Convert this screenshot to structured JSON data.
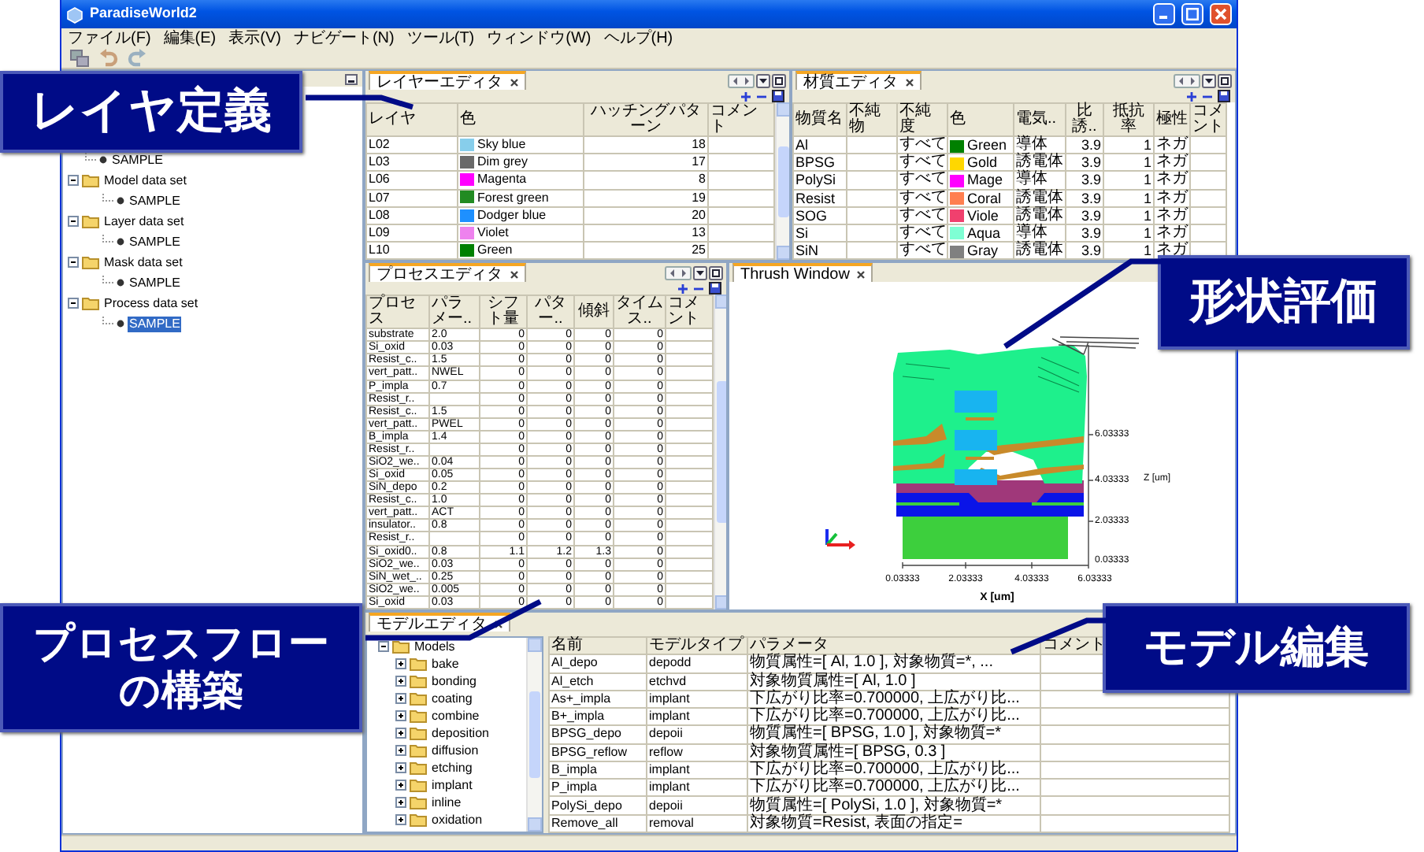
{
  "window": {
    "title": "ParadiseWorld2"
  },
  "menu": [
    "ファイル(F)",
    "編集(E)",
    "表示(V)",
    "ナビゲート(N)",
    "ツール(T)",
    "ウィンドウ(W)",
    "ヘルプ(H)"
  ],
  "navigator": {
    "tree": [
      {
        "kind": "leaf",
        "label": "SAMPLE",
        "selected": false
      },
      {
        "kind": "folder",
        "label": "Model data set",
        "expanded": true,
        "children": [
          {
            "kind": "leaf",
            "label": "SAMPLE",
            "selected": false
          }
        ]
      },
      {
        "kind": "folder",
        "label": "Layer data set",
        "expanded": true,
        "children": [
          {
            "kind": "leaf",
            "label": "SAMPLE",
            "selected": false
          }
        ]
      },
      {
        "kind": "folder",
        "label": "Mask data set",
        "expanded": true,
        "children": [
          {
            "kind": "leaf",
            "label": "SAMPLE",
            "selected": false
          }
        ]
      },
      {
        "kind": "folder",
        "label": "Process data set",
        "expanded": true,
        "children": [
          {
            "kind": "leaf",
            "label": "SAMPLE",
            "selected": true
          }
        ]
      }
    ]
  },
  "layer_editor": {
    "tab": {
      "label": "レイヤーエディタ",
      "selected": true
    },
    "columns": [
      {
        "label": "レイヤ",
        "kind": "text"
      },
      {
        "label": "色",
        "kind": "color"
      },
      {
        "label": "ハッチングパターン",
        "kind": "number"
      },
      {
        "label": "コメント",
        "kind": "text"
      }
    ],
    "rows": [
      [
        "L02",
        {
          "name": "Sky blue",
          "color": "#87ceeb"
        },
        "18"
      ],
      [
        "L03",
        {
          "name": "Dim grey",
          "color": "#696969"
        },
        "17"
      ],
      [
        "L06",
        {
          "name": "Magenta",
          "color": "#ff00ff"
        },
        "8"
      ],
      [
        "L07",
        {
          "name": "Forest green",
          "color": "#228b22"
        },
        "19"
      ],
      [
        "L08",
        {
          "name": "Dodger blue",
          "color": "#1e90ff"
        },
        "20"
      ],
      [
        "L09",
        {
          "name": "Violet",
          "color": "#ee82ee"
        },
        "13"
      ],
      [
        "L10",
        {
          "name": "Green",
          "color": "#008000"
        },
        "25"
      ]
    ]
  },
  "material_editor": {
    "tab": {
      "label": "材質エディタ",
      "selected": true
    },
    "columns": [
      {
        "label": "物質名",
        "kind": "text"
      },
      {
        "label": "不純物",
        "kind": "text"
      },
      {
        "label": "不純度",
        "kind": "text"
      },
      {
        "label": "色",
        "kind": "color"
      },
      {
        "label": "電気..",
        "kind": "text"
      },
      {
        "label": "比誘..",
        "kind": "number"
      },
      {
        "label": "抵抗率",
        "kind": "number"
      },
      {
        "label": "極性",
        "kind": "text"
      },
      {
        "label": "コメント",
        "kind": "text"
      }
    ],
    "rows": [
      [
        "Al",
        null,
        "すべて",
        {
          "name": "Green",
          "color": "#008000"
        },
        "導体",
        "3.9",
        "1",
        "ネガ"
      ],
      [
        "BPSG",
        null,
        "すべて",
        {
          "name": "Gold",
          "color": "#ffd700"
        },
        "誘電体",
        "3.9",
        "1",
        "ネガ"
      ],
      [
        "PolySi",
        null,
        "すべて",
        {
          "name": "Mage",
          "color": "#ff00ff"
        },
        "導体",
        "3.9",
        "1",
        "ネガ"
      ],
      [
        "Resist",
        null,
        "すべて",
        {
          "name": "Coral",
          "color": "#ff7f50"
        },
        "誘電体",
        "3.9",
        "1",
        "ネガ"
      ],
      [
        "SOG",
        null,
        "すべて",
        {
          "name": "Viole",
          "color": "#f0406e"
        },
        "誘電体",
        "3.9",
        "1",
        "ネガ"
      ],
      [
        "Si",
        null,
        "すべて",
        {
          "name": "Aqua",
          "color": "#7fffd4"
        },
        "導体",
        "3.9",
        "1",
        "ネガ"
      ],
      [
        "SiN",
        null,
        "すべて",
        {
          "name": "Gray",
          "color": "#808080"
        },
        "誘電体",
        "3.9",
        "1",
        "ネガ"
      ]
    ]
  },
  "process_editor": {
    "tab": {
      "label": "プロセスエディタ",
      "selected": true
    },
    "columns": [
      {
        "label": "プロセス",
        "kind": "text"
      },
      {
        "label": "パラメー..",
        "kind": "text"
      },
      {
        "label": "シフト量",
        "kind": "number"
      },
      {
        "label": "パター..",
        "kind": "number"
      },
      {
        "label": "傾斜",
        "kind": "number"
      },
      {
        "label": "タイムス..",
        "kind": "number"
      },
      {
        "label": "コメント",
        "kind": "text"
      }
    ],
    "rows": [
      [
        "substrate",
        "2.0",
        "0",
        "0",
        "0",
        "0"
      ],
      [
        "Si_oxid",
        "0.03",
        "0",
        "0",
        "0",
        "0"
      ],
      [
        "Resist_c..",
        "1.5",
        "0",
        "0",
        "0",
        "0"
      ],
      [
        "vert_patt..",
        "NWEL",
        "0",
        "0",
        "0",
        "0"
      ],
      [
        "P_impla",
        "0.7",
        "0",
        "0",
        "0",
        "0"
      ],
      [
        "Resist_r..",
        null,
        "0",
        "0",
        "0",
        "0"
      ],
      [
        "Resist_c..",
        "1.5",
        "0",
        "0",
        "0",
        "0"
      ],
      [
        "vert_patt..",
        "PWEL",
        "0",
        "0",
        "0",
        "0"
      ],
      [
        "B_impla",
        "1.4",
        "0",
        "0",
        "0",
        "0"
      ],
      [
        "Resist_r..",
        null,
        "0",
        "0",
        "0",
        "0"
      ],
      [
        "SiO2_we..",
        "0.04",
        "0",
        "0",
        "0",
        "0"
      ],
      [
        "Si_oxid",
        "0.05",
        "0",
        "0",
        "0",
        "0"
      ],
      [
        "SiN_depo",
        "0.2",
        "0",
        "0",
        "0",
        "0"
      ],
      [
        "Resist_c..",
        "1.0",
        "0",
        "0",
        "0",
        "0"
      ],
      [
        "vert_patt..",
        "ACT",
        "0",
        "0",
        "0",
        "0"
      ],
      [
        "insulator..",
        "0.8",
        "0",
        "0",
        "0",
        "0"
      ],
      [
        "Resist_r..",
        null,
        "0",
        "0",
        "0",
        "0"
      ],
      [
        "Si_oxid0..",
        "0.8",
        "1.1",
        "1.2",
        "1.3",
        "0"
      ],
      [
        "SiO2_we..",
        "0.03",
        "0",
        "0",
        "0",
        "0"
      ],
      [
        "SiN_wet_..",
        "0.25",
        "0",
        "0",
        "0",
        "0"
      ],
      [
        "SiO2_we..",
        "0.005",
        "0",
        "0",
        "0",
        "0"
      ],
      [
        "Si_oxid",
        "0.03",
        "0",
        "0",
        "0",
        "0"
      ]
    ]
  },
  "thrush_window": {
    "tab": {
      "label": "Thrush Window",
      "selected": true
    },
    "x_ticks": [
      "0.03333",
      "2.03333",
      "4.03333",
      "6.03333"
    ],
    "x_label": "X [um]",
    "z_ticks": [
      "6.03333",
      "4.03333",
      "2.03333",
      "0.03333"
    ],
    "z_label": "Z [um]"
  },
  "model_editor": {
    "tab": {
      "label": "モデルエディタ",
      "selected": true
    },
    "tree": [
      {
        "kind": "folder",
        "label": "Models",
        "expanded": true,
        "children": [
          {
            "kind": "folder",
            "label": "bake",
            "expanded": false
          },
          {
            "kind": "folder",
            "label": "bonding",
            "expanded": false
          },
          {
            "kind": "folder",
            "label": "coating",
            "expanded": false
          },
          {
            "kind": "folder",
            "label": "combine",
            "expanded": false
          },
          {
            "kind": "folder",
            "label": "deposition",
            "expanded": false
          },
          {
            "kind": "folder",
            "label": "diffusion",
            "expanded": false
          },
          {
            "kind": "folder",
            "label": "etching",
            "expanded": false
          },
          {
            "kind": "folder",
            "label": "implant",
            "expanded": false
          },
          {
            "kind": "folder",
            "label": "inline",
            "expanded": false
          },
          {
            "kind": "folder",
            "label": "oxidation",
            "expanded": false
          }
        ]
      }
    ],
    "columns": [
      {
        "label": "名前",
        "kind": "text"
      },
      {
        "label": "モデルタイプ",
        "kind": "text"
      },
      {
        "label": "パラメータ",
        "kind": "text"
      },
      {
        "label": "コメント",
        "kind": "text"
      }
    ],
    "rows": [
      [
        "Al_depo",
        "depodd",
        "物質属性=[ Al, 1.0 ], 対象物質=*, ..."
      ],
      [
        "Al_etch",
        "etchvd",
        "対象物質属性=[ Al, 1.0 ]"
      ],
      [
        "As+_impla",
        "implant",
        "下広がり比率=0.700000, 上広がり比..."
      ],
      [
        "B+_impla",
        "implant",
        "下広がり比率=0.700000, 上広がり比..."
      ],
      [
        "BPSG_depo",
        "depoii",
        "物質属性=[ BPSG, 1.0 ], 対象物質=*"
      ],
      [
        "BPSG_reflow",
        "reflow",
        "対象物質属性=[ BPSG, 0.3 ]"
      ],
      [
        "B_impla",
        "implant",
        "下広がり比率=0.700000, 上広がり比..."
      ],
      [
        "P_impla",
        "implant",
        "下広がり比率=0.700000, 上広がり比..."
      ],
      [
        "PolySi_depo",
        "depoii",
        "物質属性=[ PolySi, 1.0 ], 対象物質=*"
      ],
      [
        "Remove_all",
        "removal",
        "対象物質=Resist, 表面の指定="
      ]
    ]
  },
  "callouts": [
    {
      "lines": [
        "レイヤ定義"
      ]
    },
    {
      "lines": [
        "形状評価"
      ]
    },
    {
      "lines": [
        "プロセスフロー",
        "の構築"
      ]
    },
    {
      "lines": [
        "モデル編集"
      ]
    }
  ]
}
